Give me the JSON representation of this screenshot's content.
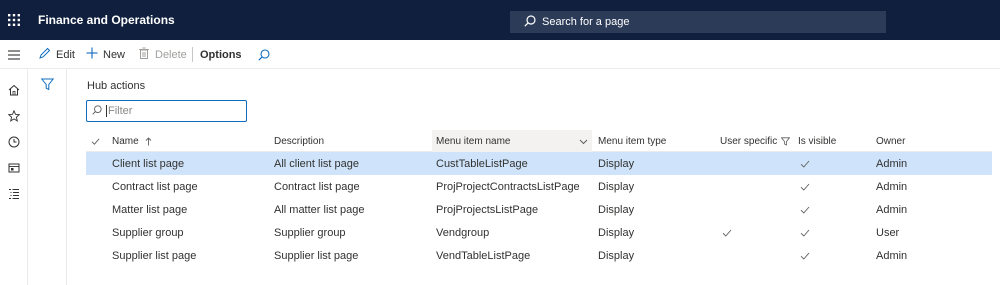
{
  "app": {
    "title": "Finance and Operations"
  },
  "search": {
    "placeholder": "Search for a page"
  },
  "actions": {
    "edit": "Edit",
    "new": "New",
    "delete": "Delete",
    "options": "Options"
  },
  "page": {
    "heading": "Hub actions",
    "filter_placeholder": "Filter"
  },
  "grid": {
    "columns": {
      "name": "Name",
      "description": "Description",
      "menu_item_name": "Menu item name",
      "menu_item_type": "Menu item type",
      "user_specific": "User specific",
      "is_visible": "Is visible",
      "owner": "Owner"
    },
    "sort": {
      "column": "Name",
      "direction": "ascending"
    },
    "rows": [
      {
        "name": "Client list page",
        "description": "All client list page",
        "menu_item_name": "CustTableListPage",
        "menu_item_type": "Display",
        "user_specific": false,
        "is_visible": true,
        "owner": "Admin",
        "selected": true
      },
      {
        "name": "Contract list page",
        "description": "Contract list page",
        "menu_item_name": "ProjProjectContractsListPage",
        "menu_item_type": "Display",
        "user_specific": false,
        "is_visible": true,
        "owner": "Admin",
        "selected": false
      },
      {
        "name": "Matter list page",
        "description": "All matter list page",
        "menu_item_name": "ProjProjectsListPage",
        "menu_item_type": "Display",
        "user_specific": false,
        "is_visible": true,
        "owner": "Admin",
        "selected": false
      },
      {
        "name": "Supplier group",
        "description": "Supplier group",
        "menu_item_name": "Vendgroup",
        "menu_item_type": "Display",
        "user_specific": true,
        "is_visible": true,
        "owner": "User",
        "selected": false
      },
      {
        "name": "Supplier list page",
        "description": "Supplier list page",
        "menu_item_name": "VendTableListPage",
        "menu_item_type": "Display",
        "user_specific": false,
        "is_visible": true,
        "owner": "Admin",
        "selected": false
      }
    ]
  },
  "nav_icons": [
    "home-icon",
    "star-icon",
    "clock-icon",
    "workspace-icon",
    "modules-list-icon"
  ],
  "colors": {
    "topbar": "#0f1f3d",
    "search_bg": "#2c3b58",
    "selected_row": "#cfe4fa",
    "accent": "#0f6cbd"
  }
}
